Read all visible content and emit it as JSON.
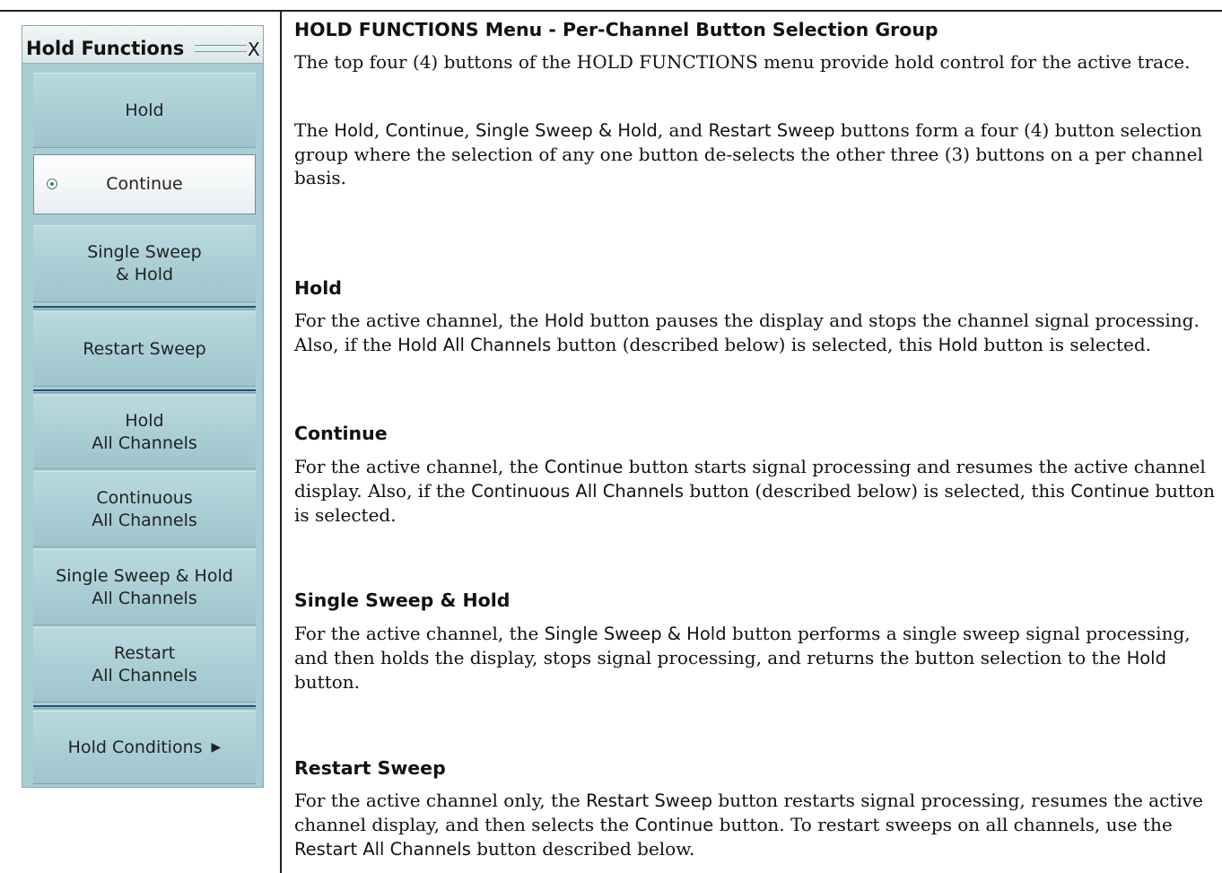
{
  "menu": {
    "title": "Hold Functions",
    "close": "X",
    "buttons": [
      {
        "label": "Hold"
      },
      {
        "label": "Continue"
      },
      {
        "label": "Single Sweep\n& Hold"
      },
      {
        "label": "Restart Sweep"
      },
      {
        "label": "Hold\nAll Channels"
      },
      {
        "label": "Continuous\nAll Channels"
      },
      {
        "label": "Single Sweep & Hold\nAll Channels"
      },
      {
        "label": "Restart\nAll Channels"
      },
      {
        "label": "Hold Conditions"
      }
    ],
    "selected": "Continue"
  },
  "doc": {
    "heading": "HOLD FUNCTIONS Menu - Per-Channel Button Selection Group",
    "intro1": "The top four (4) buttons of the HOLD FUNCTIONS menu provide hold control for the active trace.",
    "intro2": {
      "a": "The ",
      "b1": "Hold",
      "c1": ", ",
      "b2": "Continue",
      "c2": ", ",
      "b3": "Single Sweep & Hold",
      "c3": ", and ",
      "b4": "Restart Sweep",
      "c4": " buttons form a four (4) button selection group where the selection of any one button de-selects the other three (3) buttons on a per channel basis."
    },
    "hold": {
      "heading": "Hold",
      "t1": "For the active channel, the ",
      "s1": "Hold",
      "t2": " button pauses the display and stops the channel signal processing. Also, if the ",
      "s2": "Hold All Channels",
      "t3": " button (described below) is selected, this ",
      "s3": "Hold",
      "t4": " button is selected."
    },
    "continue": {
      "heading": "Continue",
      "t1": "For the active channel, the ",
      "s1": "Continue",
      "t2": " button starts signal processing and resumes the active channel display. Also, if the ",
      "s2": "Continuous All Channels",
      "t3": " button (described below) is selected, this ",
      "s3": "Continue",
      "t4": " button is selected."
    },
    "single": {
      "heading": "Single Sweep & Hold",
      "t1": "For the active channel, the ",
      "s1": "Single Sweep & Hold",
      "t2": " button performs a single sweep signal processing, and then holds the display, stops signal processing, and returns the button selection to the ",
      "s2": "Hold",
      "t3": " button."
    },
    "restart": {
      "heading": "Restart Sweep",
      "t1": "For the active channel only, the ",
      "s1": "Restart Sweep",
      "t2": " button restarts signal processing, resumes the active channel display, and then selects the ",
      "s2": "Continue",
      "t3": " button. To restart sweeps on all channels, use the ",
      "s3": "Restart All Channels",
      "t4": " button described below."
    }
  }
}
